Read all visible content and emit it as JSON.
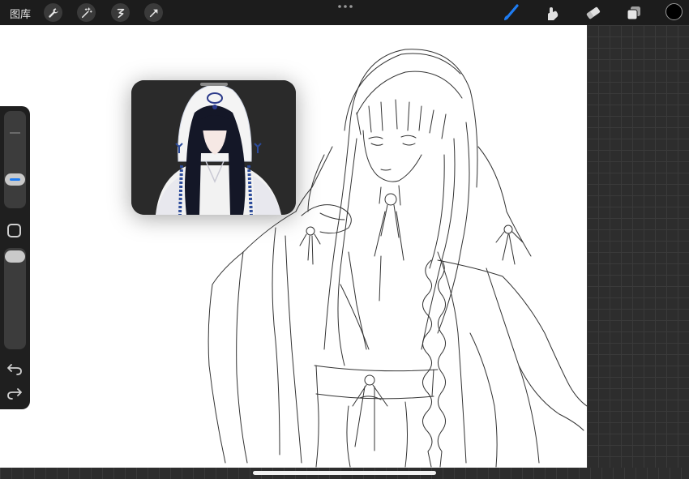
{
  "topbar": {
    "gallery_label": "图库",
    "left_tools": [
      "wrench-icon",
      "magic-wand-icon",
      "selection-icon",
      "transform-arrow-icon"
    ],
    "right_tools": [
      "brush-icon",
      "smudge-icon",
      "eraser-icon",
      "layers-icon"
    ],
    "active_tool": "brush-icon",
    "accent_color": "#1e7cf2",
    "current_color": "#000000"
  },
  "sidebar": {
    "size_slider_level": 0.25,
    "opacity_slider_level": 1.0
  },
  "reference": {
    "content": "reference-image"
  }
}
